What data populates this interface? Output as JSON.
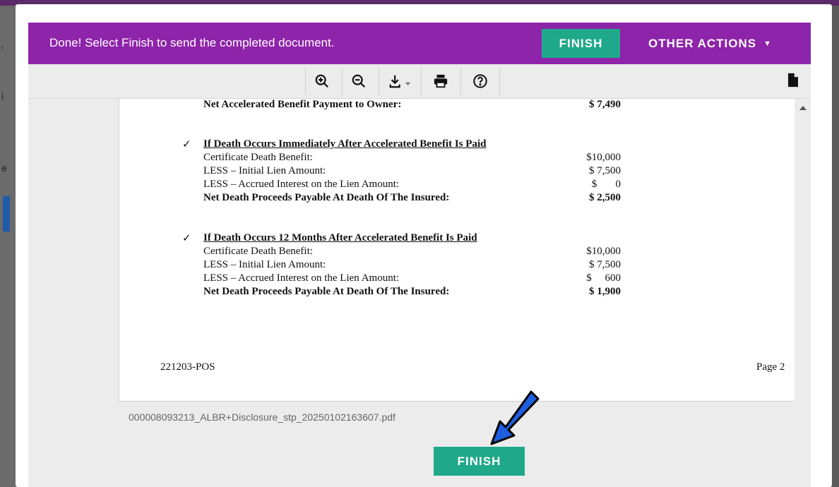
{
  "background": {
    "fragments": [
      "'",
      "i",
      "e"
    ]
  },
  "banner": {
    "message": "Done! Select Finish to send the completed document.",
    "finish_label": "FINISH",
    "other_actions_label": "OTHER ACTIONS",
    "color": "#8e24aa",
    "button_color": "#20a88a"
  },
  "toolbar": {
    "tools": [
      "zoom-in-icon",
      "zoom-out-icon",
      "download-icon",
      "print-icon",
      "help-icon"
    ],
    "side_icon": "document-icon"
  },
  "document": {
    "top_partial": {
      "label": "Net Accelerated Benefit Payment to Owner:",
      "amount": "$ 7,490"
    },
    "sections": [
      {
        "check": "✓",
        "heading": "If Death Occurs Immediately After Accelerated Benefit Is Paid",
        "rows": [
          {
            "label": "Certificate Death Benefit:",
            "amount": "$10,000"
          },
          {
            "label": "LESS – Initial Lien Amount:",
            "amount": "$ 7,500"
          },
          {
            "label": "LESS – Accrued Interest on the Lien Amount:",
            "amount": "$       0"
          }
        ],
        "total": {
          "label": "Net Death Proceeds Payable At Death Of The Insured:",
          "amount": "$ 2,500"
        }
      },
      {
        "check": "✓",
        "heading": "If Death Occurs 12 Months After Accelerated Benefit Is Paid",
        "rows": [
          {
            "label": "Certificate Death Benefit:",
            "amount": "$10,000"
          },
          {
            "label": "LESS – Initial Lien Amount:",
            "amount": "$ 7,500"
          },
          {
            "label": "LESS – Accrued Interest on the Lien Amount:",
            "amount": "$     600"
          }
        ],
        "total": {
          "label": "Net Death Proceeds Payable At Death Of The Insured:",
          "amount": "$ 1,900"
        }
      }
    ],
    "footer_left": "221203-POS",
    "footer_right": "Page 2"
  },
  "filename": "000008093213_ALBR+Disclosure_stp_20250102163607.pdf",
  "bottom_finish_label": "FINISH",
  "arrow_color": "#1e5fe0"
}
